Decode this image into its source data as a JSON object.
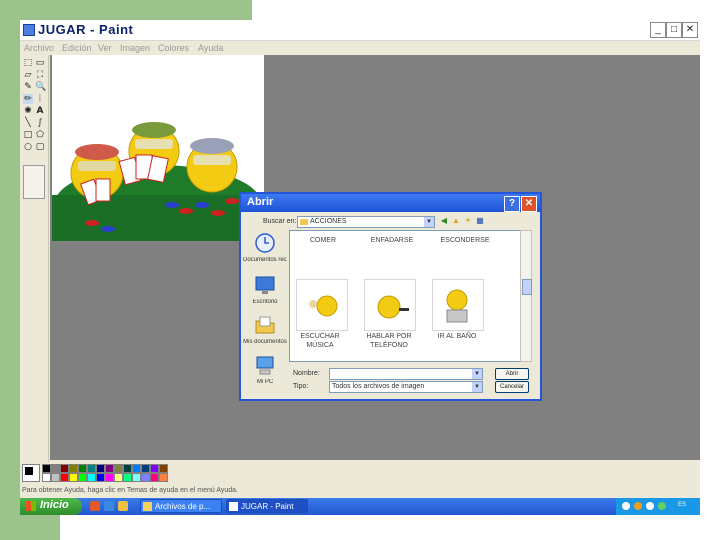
{
  "window": {
    "title": "JUGAR - Paint",
    "min": "_",
    "max": "□",
    "close": "✕"
  },
  "menubar": {
    "items": [
      {
        "label": "Archivo"
      },
      {
        "label": "Edición"
      },
      {
        "label": "Ver"
      },
      {
        "label": "Imagen"
      },
      {
        "label": "Colores"
      },
      {
        "label": "Ayuda"
      }
    ]
  },
  "toolbox": {
    "tools": [
      {
        "icon": "free-select-icon",
        "glyph": "⬚"
      },
      {
        "icon": "select-icon",
        "glyph": "▭"
      },
      {
        "icon": "eraser-icon",
        "glyph": "▱"
      },
      {
        "icon": "fill-icon",
        "glyph": "⛶"
      },
      {
        "icon": "color-picker-icon",
        "glyph": "✎"
      },
      {
        "icon": "magnifier-icon",
        "glyph": "🔍"
      },
      {
        "icon": "pencil-icon",
        "glyph": "✏"
      },
      {
        "icon": "brush-icon",
        "glyph": "ᛁ"
      },
      {
        "icon": "airbrush-icon",
        "glyph": "✺"
      },
      {
        "icon": "text-icon",
        "glyph": "A"
      },
      {
        "icon": "line-icon",
        "glyph": "╲"
      },
      {
        "icon": "curve-icon",
        "glyph": "∫"
      },
      {
        "icon": "rectangle-icon",
        "glyph": "□"
      },
      {
        "icon": "polygon-icon",
        "glyph": "⬠"
      },
      {
        "icon": "ellipse-icon",
        "glyph": "○"
      },
      {
        "icon": "rounded-rect-icon",
        "glyph": "▢"
      }
    ]
  },
  "dialog": {
    "title": "Abrir",
    "help_button": "?",
    "close_button": "✕",
    "lookin_label": "Buscar en:",
    "lookin_value": "ACCIONES",
    "places": [
      {
        "label": "Documentos recientes"
      },
      {
        "label": "Escritorio"
      },
      {
        "label": "Mis documentos"
      },
      {
        "label": "Mi PC"
      }
    ],
    "files_top_row": [
      {
        "label": "COMER"
      },
      {
        "label": "ENFADARSE"
      },
      {
        "label": "ESCONDERSE"
      }
    ],
    "files": [
      {
        "label_line1": "ESCUCHAR",
        "label_line2": "MÚSICA"
      },
      {
        "label_line1": "HABLAR POR",
        "label_line2": "TELÉFONO"
      },
      {
        "label_line1": "IR AL BAÑO",
        "label_line2": ""
      }
    ],
    "filename_label": "Nombre:",
    "filename_value": "",
    "filetype_label": "Tipo:",
    "filetype_value": "Todos los archivos de imagen",
    "open_button": "Abrir",
    "cancel_button": "Cancelar"
  },
  "palette": {
    "colors": [
      "#000000",
      "#808080",
      "#800000",
      "#808000",
      "#008000",
      "#008080",
      "#000080",
      "#800080",
      "#808040",
      "#004040",
      "#0080ff",
      "#004080",
      "#8000ff",
      "#804000",
      "#ffffff",
      "#c0c0c0",
      "#ff0000",
      "#ffff00",
      "#00ff00",
      "#00ffff",
      "#0000ff",
      "#ff00ff",
      "#ffff80",
      "#00ff80",
      "#80ffff",
      "#8080ff",
      "#ff0080",
      "#ff8040"
    ]
  },
  "status": {
    "text": "Para obtener Ayuda, haga clic en Temas de ayuda en el menú Ayuda."
  },
  "taskbar": {
    "start_label": "Inicio",
    "tasks": [
      {
        "label": "Archivos de p..."
      },
      {
        "label": "JUGAR - Paint"
      }
    ],
    "tray_label": "ES"
  }
}
